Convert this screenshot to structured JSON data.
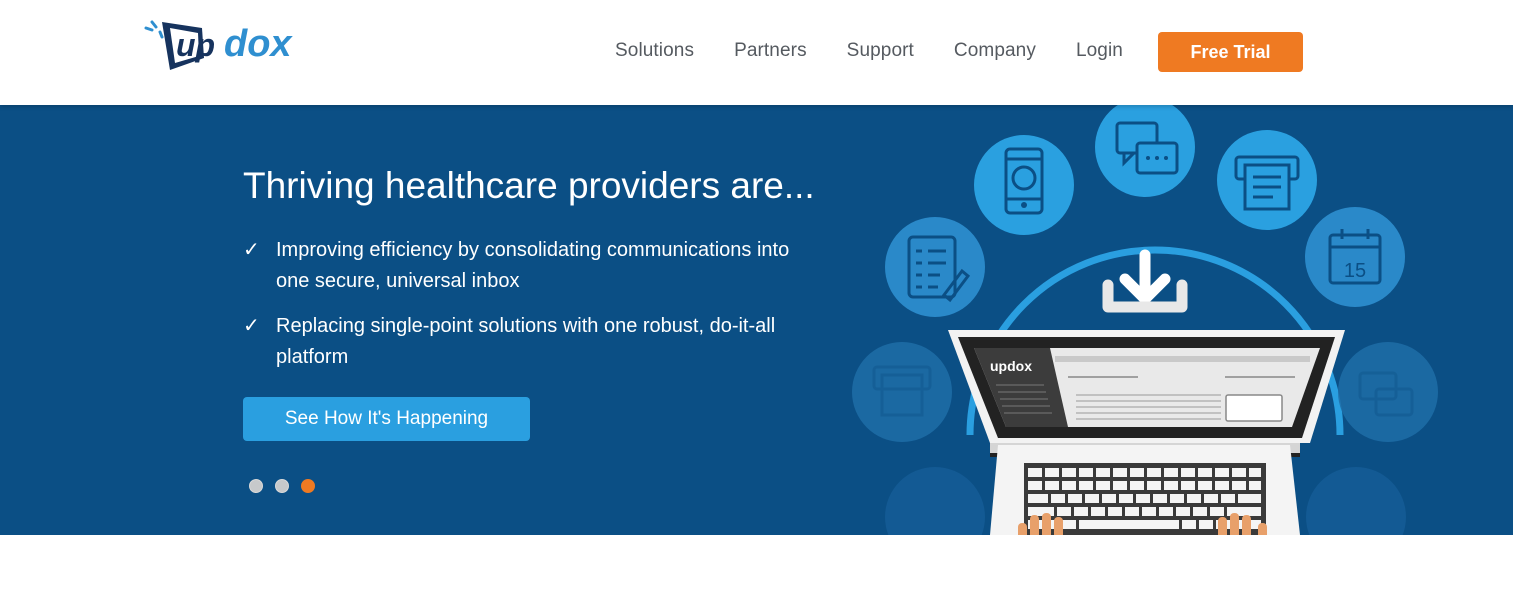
{
  "header": {
    "logo_text": "updox",
    "nav": [
      "Solutions",
      "Partners",
      "Support",
      "Company",
      "Login"
    ],
    "cta_label": "Free Trial"
  },
  "hero": {
    "title": "Thriving healthcare providers are...",
    "bullets": [
      "Improving efficiency by consolidating communications into one secure, universal inbox",
      "Replacing single-point solutions with one robust, do-it-all platform"
    ],
    "check_glyph": "✓",
    "button_label": "See How It's Happening",
    "carousel_dots": 3,
    "active_dot": 3,
    "calendar_number": "15",
    "screen_logo_text": "updox"
  },
  "colors": {
    "brand_blue": "#0b4f85",
    "accent_orange": "#ef7a22",
    "button_blue": "#2a9fe0",
    "logo_blue": "#2f8fd0",
    "logo_navy": "#16335e"
  }
}
